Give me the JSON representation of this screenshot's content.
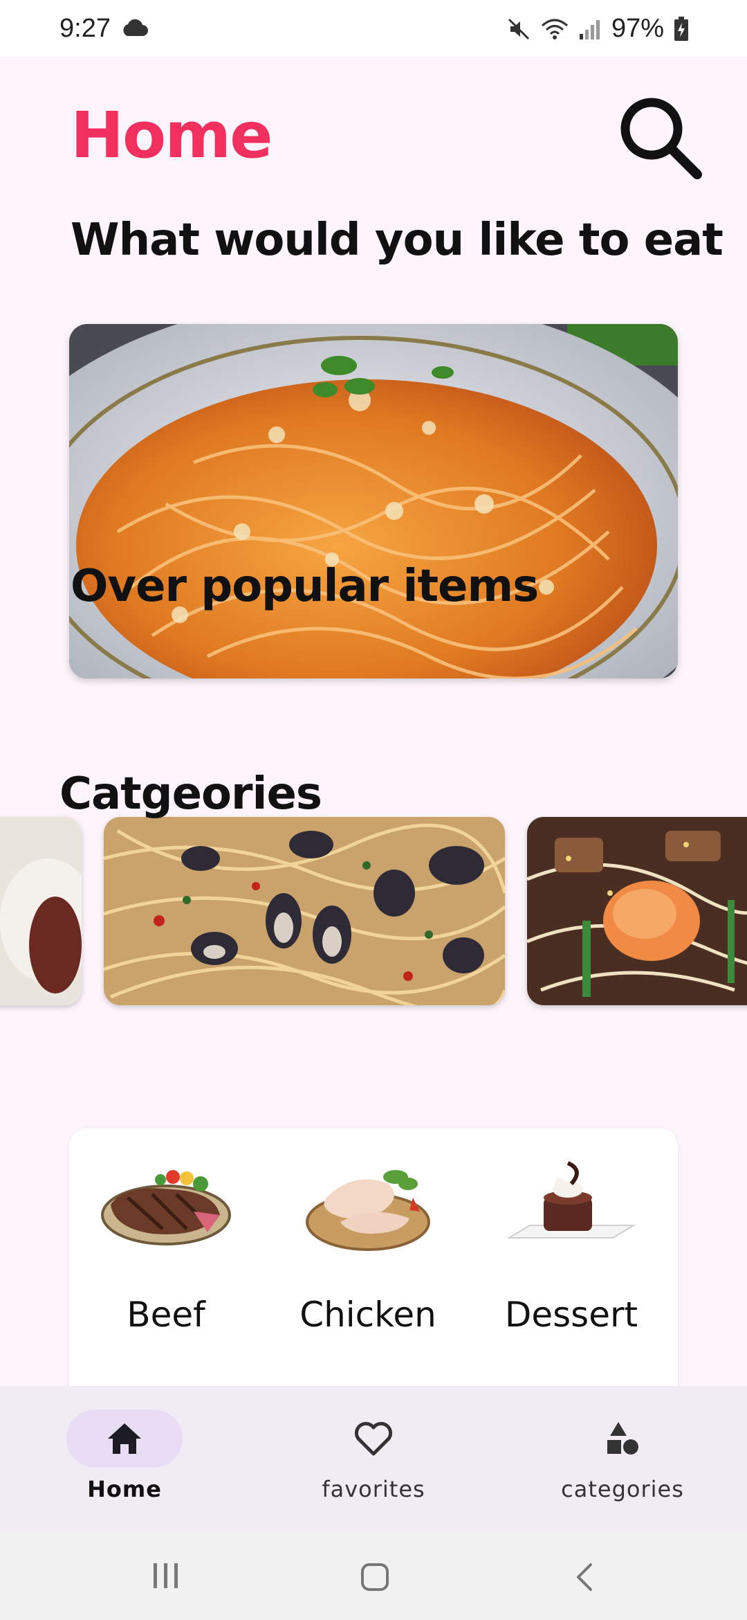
{
  "status_bar": {
    "time": "9:27",
    "battery": "97%"
  },
  "header": {
    "title": "Home"
  },
  "sections": {
    "prompt": "What would you like to eat",
    "popular": "Over popular items",
    "categories": "Catgeories"
  },
  "categories": [
    {
      "label": "Beef"
    },
    {
      "label": "Chicken"
    },
    {
      "label": "Dessert"
    }
  ],
  "nav": {
    "items": [
      {
        "label": "Home",
        "icon": "home-icon",
        "active": true
      },
      {
        "label": "favorites",
        "icon": "heart-icon",
        "active": false
      },
      {
        "label": "categories",
        "icon": "shapes-icon",
        "active": false
      }
    ]
  },
  "colors": {
    "accent": "#f2305f",
    "nav_active_pill": "#e8ddf5",
    "background": "#fdf5fb"
  }
}
